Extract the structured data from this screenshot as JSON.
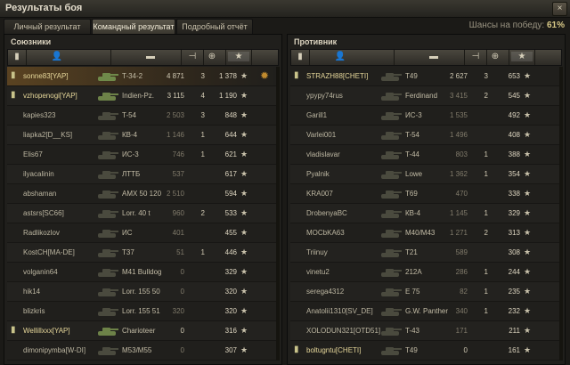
{
  "window": {
    "title": "Результаты боя",
    "close_label": "×"
  },
  "tabs": [
    {
      "label": "Личный результат",
      "active": false
    },
    {
      "label": "Командный результат",
      "active": true
    },
    {
      "label": "Подробный отчёт",
      "active": false
    }
  ],
  "win_chance": {
    "label": "Шансы на победу:",
    "value": "61%"
  },
  "allies": {
    "title": "Союзники",
    "rows": [
      {
        "player": "sonne83[YAP]",
        "tank": "T-34-2",
        "damage": "4 871",
        "kills": "3",
        "xp": "1 378",
        "platoon": true,
        "highlight": true,
        "achievement": true,
        "tank_color": "#6f8a4a"
      },
      {
        "player": "vzhopenogi[YAP]",
        "tank": "Indien-Pz.",
        "damage": "3 115",
        "kills": "4",
        "xp": "1 190",
        "platoon": true,
        "highlight": false,
        "achievement": false,
        "tank_color": "#6d8248"
      },
      {
        "player": "kapies323",
        "tank": "T-54",
        "damage": "2 503",
        "kills": "3",
        "xp": "848",
        "platoon": false,
        "highlight": false,
        "achievement": false,
        "tank_color": "#4a4a3e"
      },
      {
        "player": "liapka2[D__KS]",
        "tank": "КВ-4",
        "damage": "1 146",
        "kills": "1",
        "xp": "644",
        "platoon": false,
        "highlight": false,
        "achievement": false,
        "tank_color": "#4a4a3e"
      },
      {
        "player": "Elis67",
        "tank": "ИС-3",
        "damage": "746",
        "kills": "1",
        "xp": "621",
        "platoon": false,
        "highlight": false,
        "achievement": false,
        "tank_color": "#4a4a3e"
      },
      {
        "player": "ilyacalinin",
        "tank": "ЛТТБ",
        "damage": "537",
        "kills": "",
        "xp": "617",
        "platoon": false,
        "highlight": false,
        "achievement": false,
        "tank_color": "#4a4a3e"
      },
      {
        "player": "abshaman",
        "tank": "AMX 50 120",
        "damage": "2 510",
        "kills": "",
        "xp": "594",
        "platoon": false,
        "highlight": false,
        "achievement": false,
        "tank_color": "#4a4a3e"
      },
      {
        "player": "astsrs[SC66]",
        "tank": "Lorr. 40 t",
        "damage": "960",
        "kills": "2",
        "xp": "533",
        "platoon": false,
        "highlight": false,
        "achievement": false,
        "tank_color": "#4a4a3e"
      },
      {
        "player": "Radlikozlov",
        "tank": "ИС",
        "damage": "401",
        "kills": "",
        "xp": "455",
        "platoon": false,
        "highlight": false,
        "achievement": false,
        "tank_color": "#4a4a3e"
      },
      {
        "player": "KostCH[MA-DE]",
        "tank": "T37",
        "damage": "51",
        "kills": "1",
        "xp": "446",
        "platoon": false,
        "highlight": false,
        "achievement": false,
        "tank_color": "#4a4a3e"
      },
      {
        "player": "volganin64",
        "tank": "M41 Bulldog",
        "damage": "0",
        "kills": "",
        "xp": "329",
        "platoon": false,
        "highlight": false,
        "achievement": false,
        "tank_color": "#4a4a3e"
      },
      {
        "player": "hik14",
        "tank": "Lorr. 155 50",
        "damage": "0",
        "kills": "",
        "xp": "320",
        "platoon": false,
        "highlight": false,
        "achievement": false,
        "tank_color": "#4a4a3e"
      },
      {
        "player": "blizkris",
        "tank": "Lorr. 155 51",
        "damage": "320",
        "kills": "",
        "xp": "320",
        "platoon": false,
        "highlight": false,
        "achievement": false,
        "tank_color": "#4a4a3e"
      },
      {
        "player": "Wellillxxx[YAP]",
        "tank": "Charioteer",
        "damage": "0",
        "kills": "",
        "xp": "316",
        "platoon": true,
        "highlight": false,
        "achievement": false,
        "tank_color": "#6d8248"
      },
      {
        "player": "dimonipymba[W-DI]",
        "tank": "M53/M55",
        "damage": "0",
        "kills": "",
        "xp": "307",
        "platoon": false,
        "highlight": false,
        "achievement": false,
        "tank_color": "#4a4a3e"
      }
    ]
  },
  "enemies": {
    "title": "Противник",
    "rows": [
      {
        "player": "STRAZH88[CHETI]",
        "tank": "T49",
        "damage": "2 627",
        "kills": "3",
        "xp": "653",
        "platoon": true,
        "highlight": false,
        "achievement": false,
        "tank_color": "#4a4a3e"
      },
      {
        "player": "ypypy74rus",
        "tank": "Ferdinand",
        "damage": "3 415",
        "kills": "2",
        "xp": "545",
        "platoon": false,
        "highlight": false,
        "achievement": false,
        "tank_color": "#4a4a3e"
      },
      {
        "player": "Garill1",
        "tank": "ИС-3",
        "damage": "1 535",
        "kills": "",
        "xp": "492",
        "platoon": false,
        "highlight": false,
        "achievement": false,
        "tank_color": "#4a4a3e"
      },
      {
        "player": "Varlei001",
        "tank": "T-54",
        "damage": "1 496",
        "kills": "",
        "xp": "408",
        "platoon": false,
        "highlight": false,
        "achievement": false,
        "tank_color": "#4a4a3e"
      },
      {
        "player": "vladislavar",
        "tank": "T-44",
        "damage": "803",
        "kills": "1",
        "xp": "388",
        "platoon": false,
        "highlight": false,
        "achievement": false,
        "tank_color": "#4a4a3e"
      },
      {
        "player": "Pyalnik",
        "tank": "Lowe",
        "damage": "1 362",
        "kills": "1",
        "xp": "354",
        "platoon": false,
        "highlight": false,
        "achievement": false,
        "tank_color": "#4a4a3e"
      },
      {
        "player": "KRA007",
        "tank": "T69",
        "damage": "470",
        "kills": "",
        "xp": "338",
        "platoon": false,
        "highlight": false,
        "achievement": false,
        "tank_color": "#4a4a3e"
      },
      {
        "player": "DrobenyaBC",
        "tank": "КВ-4",
        "damage": "1 145",
        "kills": "1",
        "xp": "329",
        "platoon": false,
        "highlight": false,
        "achievement": false,
        "tank_color": "#4a4a3e"
      },
      {
        "player": "MOCbKA63",
        "tank": "M40/M43",
        "damage": "1 271",
        "kills": "2",
        "xp": "313",
        "platoon": false,
        "highlight": false,
        "achievement": false,
        "tank_color": "#4a4a3e"
      },
      {
        "player": "Triinuy",
        "tank": "T21",
        "damage": "589",
        "kills": "",
        "xp": "308",
        "platoon": false,
        "highlight": false,
        "achievement": false,
        "tank_color": "#4a4a3e"
      },
      {
        "player": "vinetu2",
        "tank": "212A",
        "damage": "286",
        "kills": "1",
        "xp": "244",
        "platoon": false,
        "highlight": false,
        "achievement": false,
        "tank_color": "#4a4a3e"
      },
      {
        "player": "serega4312",
        "tank": "E 75",
        "damage": "82",
        "kills": "1",
        "xp": "235",
        "platoon": false,
        "highlight": false,
        "achievement": false,
        "tank_color": "#4a4a3e"
      },
      {
        "player": "Anatolii1310[SV_DE]",
        "tank": "G.W. Panther",
        "damage": "340",
        "kills": "1",
        "xp": "232",
        "platoon": false,
        "highlight": false,
        "achievement": false,
        "tank_color": "#4a4a3e"
      },
      {
        "player": "XOLODUN321[OTD51]",
        "tank": "T-43",
        "damage": "171",
        "kills": "",
        "xp": "211",
        "platoon": false,
        "highlight": false,
        "achievement": false,
        "tank_color": "#4a4a3e"
      },
      {
        "player": "boltugntu[CHETI]",
        "tank": "T49",
        "damage": "0",
        "kills": "",
        "xp": "161",
        "platoon": true,
        "highlight": false,
        "achievement": false,
        "tank_color": "#4a4a3e"
      }
    ]
  },
  "icons": {
    "medal": "medal-icon",
    "player": "player-icon",
    "tank": "tank-icon",
    "damage": "damage-icon",
    "kills": "kills-icon",
    "xp": "star-icon"
  }
}
